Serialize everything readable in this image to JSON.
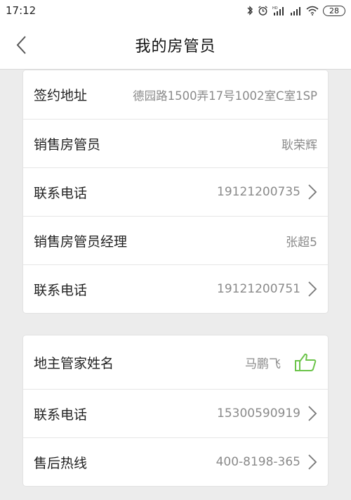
{
  "status_bar": {
    "time": "17:12",
    "battery": "28",
    "icons": [
      "bluetooth-icon",
      "alarm-icon",
      "hd-signal-icon",
      "signal-icon",
      "wifi-icon",
      "battery-icon"
    ]
  },
  "header": {
    "title": "我的房管员",
    "back_icon": "chevron-left-icon"
  },
  "card1": {
    "rows": [
      {
        "label": "签约地址",
        "value": "德园路1500弄17号1002室C室1SP"
      },
      {
        "label": "销售房管员",
        "value": "耿荣辉"
      },
      {
        "label": "联系电话",
        "value": "19121200735"
      },
      {
        "label": "销售房管员经理",
        "value": "张超5"
      },
      {
        "label": "联系电话",
        "value": "19121200751"
      }
    ]
  },
  "card2": {
    "rows": [
      {
        "label": "地主管家姓名",
        "value": "马鹏飞"
      },
      {
        "label": "联系电话",
        "value": "15300590919"
      },
      {
        "label": "售后热线",
        "value": "400-8198-365"
      }
    ]
  },
  "colors": {
    "background": "#ececec",
    "card": "#ffffff",
    "value_text": "#8a8a8a",
    "thumb_green": "#6cc44a"
  }
}
